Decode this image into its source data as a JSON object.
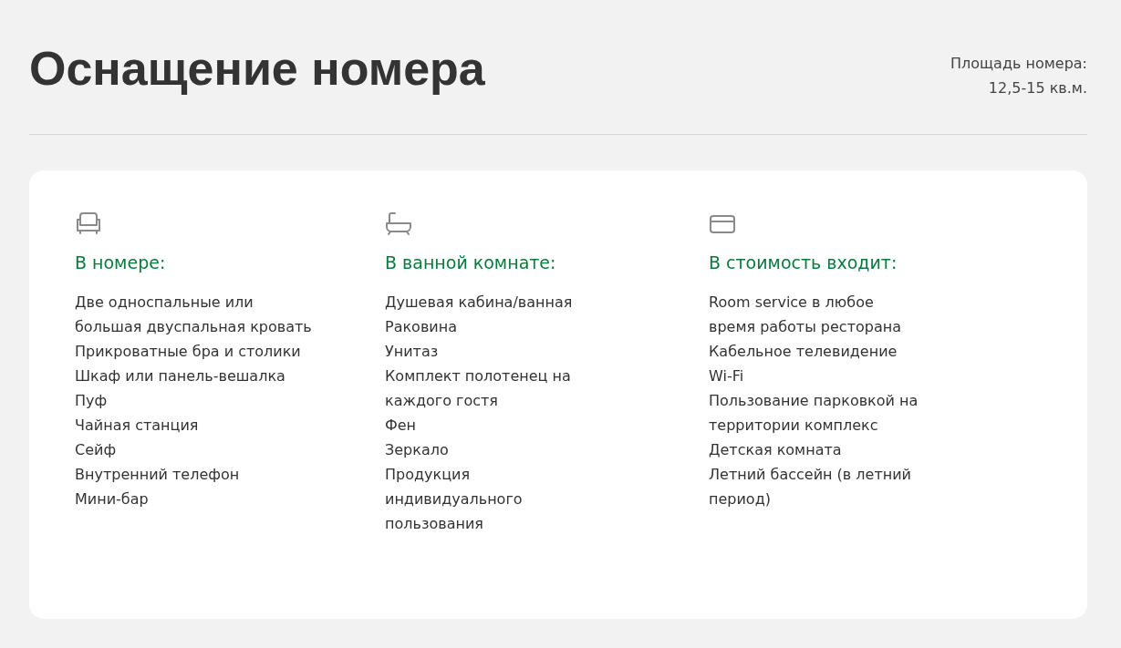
{
  "title": "Оснащение номера",
  "area": {
    "label": "Площадь номера:",
    "value": "12,5-15 кв.м."
  },
  "columns": [
    {
      "kind": "armchair",
      "heading": "В номере:",
      "items": [
        [
          "Две односпальные или",
          "большая двуспальная кровать"
        ],
        [
          "Прикроватные бра и столики"
        ],
        [
          "Шкаф или панель-вешалка"
        ],
        [
          "Пуф"
        ],
        [
          "Чайная станция"
        ],
        [
          "Сейф"
        ],
        [
          "Внутренний телефон"
        ],
        [
          "Мини-бар"
        ]
      ]
    },
    {
      "kind": "bathtub",
      "heading": "В ванной комнате:",
      "items": [
        [
          "Душевая кабина/ванная"
        ],
        [
          "Раковина"
        ],
        [
          "Унитаз"
        ],
        [
          "Комплект полотенец на",
          "каждого гостя"
        ],
        [
          "Фен"
        ],
        [
          "Зеркало"
        ],
        [
          "Продукция",
          "индивидуального",
          "пользования"
        ]
      ]
    },
    {
      "kind": "card",
      "heading": "В стоимость входит:",
      "items": [
        [
          "Room service в любое",
          "время работы ресторана"
        ],
        [
          "Кабельное телевидение"
        ],
        [
          "Wi-Fi"
        ],
        [
          "Пользование парковкой на",
          "территории комплекс"
        ],
        [
          "Детская комната"
        ],
        [
          "Летний бассейн (в летний",
          "период)"
        ]
      ]
    }
  ]
}
